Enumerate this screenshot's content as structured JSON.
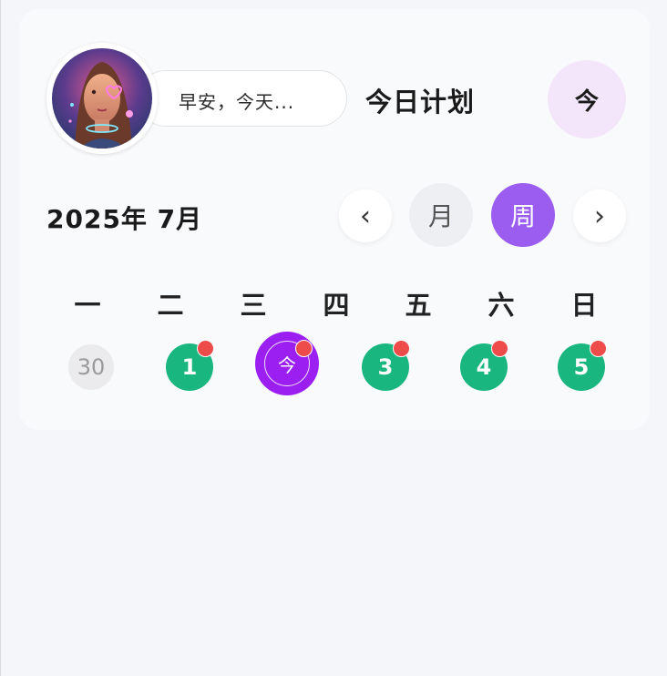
{
  "header": {
    "greeting": "早安，今天...",
    "title": "今日计划",
    "today_button": "今"
  },
  "calendar": {
    "month_label": "2025年 7月",
    "prev_icon": "‹",
    "next_icon": "›",
    "mode_month": "月",
    "mode_week": "周",
    "weekdays": [
      "一",
      "二",
      "三",
      "四",
      "五",
      "六",
      "日"
    ],
    "days": [
      {
        "label": "30",
        "state": "muted",
        "has_event": false
      },
      {
        "label": "1",
        "state": "has-plan",
        "has_event": true
      },
      {
        "label": "今",
        "state": "today",
        "has_event": true
      },
      {
        "label": "3",
        "state": "has-plan",
        "has_event": true
      },
      {
        "label": "4",
        "state": "has-plan",
        "has_event": true
      },
      {
        "label": "5",
        "state": "has-plan",
        "has_event": true
      }
    ]
  },
  "colors": {
    "accent": "#9b5cf0",
    "today": "#9a1ff0",
    "plan": "#1ab67f",
    "event_dot": "#ee4b4b",
    "today_button_bg": "#f3e6fb"
  }
}
